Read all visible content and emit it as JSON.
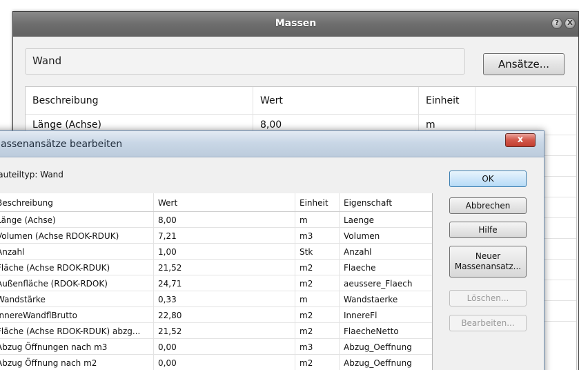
{
  "massen_window": {
    "title": "Massen",
    "help_icon": "?",
    "close_icon": "X",
    "name_value": "Wand",
    "ansaetze_button": "Ansätze...",
    "columns": [
      "Beschreibung",
      "Wert",
      "Einheit",
      ""
    ],
    "rows": [
      [
        "Länge (Achse)",
        "8,00",
        "m",
        ""
      ]
    ]
  },
  "dialog": {
    "title": "Massenansätze bearbeiten",
    "close_label": "x",
    "bauteiltyp": "Bauteiltyp: Wand",
    "columns": [
      "Beschreibung",
      "Wert",
      "Einheit",
      "Eigenschaft"
    ],
    "rows": [
      [
        "Länge (Achse)",
        "8,00",
        "m",
        "Laenge"
      ],
      [
        "Volumen (Achse RDOK-RDUK)",
        "7,21",
        "m3",
        "Volumen"
      ],
      [
        "Anzahl",
        "1,00",
        "Stk",
        "Anzahl"
      ],
      [
        "Fläche (Achse RDOK-RDUK)",
        "21,52",
        "m2",
        "Flaeche"
      ],
      [
        "Außenfläche (RDOK-RDOK)",
        "24,71",
        "m2",
        "aeussere_Flaech"
      ],
      [
        "Wandstärke",
        "0,33",
        "m",
        "Wandstaerke"
      ],
      [
        "InnereWandflBrutto",
        "22,80",
        "m2",
        "InnereFl"
      ],
      [
        "Fläche (Achse RDOK-RDUK) abzg...",
        "21,52",
        "m2",
        "FlaecheNetto"
      ],
      [
        "Abzug Öffnungen nach m3",
        "0,00",
        "m3",
        "Abzug_Oeffnung"
      ],
      [
        "Abzug Öffnung nach m2",
        "0,00",
        "m2",
        "Abzug_Oeffnung"
      ]
    ],
    "buttons": {
      "ok": "OK",
      "abbrechen": "Abbrechen",
      "hilfe": "Hilfe",
      "neuer_line1": "Neuer",
      "neuer_line2": "Massenansatz...",
      "loeschen": "Löschen...",
      "bearbeiten": "Bearbeiten..."
    }
  }
}
